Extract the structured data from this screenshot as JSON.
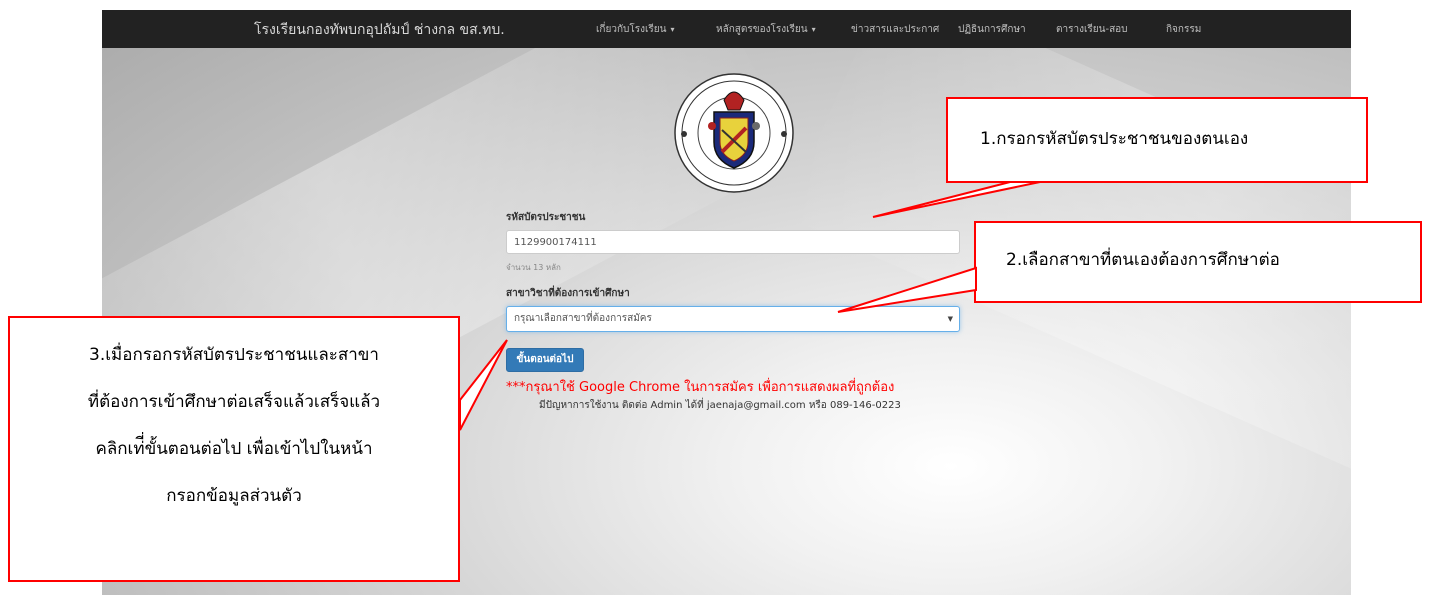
{
  "navbar": {
    "brand": "โรงเรียนกองทัพบกอุปถัมป์ ช่างกล ขส.ทบ.",
    "items": [
      {
        "label": "เกี่ยวกับโรงเรียน",
        "dropdown": true
      },
      {
        "label": "หลักสูตรของโรงเรียน",
        "dropdown": true
      },
      {
        "label": "ข่าวสารและประกาศ",
        "dropdown": false
      },
      {
        "label": "ปฏิธินการศึกษา",
        "dropdown": false
      },
      {
        "label": "ตารางเรียน-สอบ",
        "dropdown": false
      },
      {
        "label": "กิจกรรม",
        "dropdown": false
      }
    ],
    "caret": "▾"
  },
  "form": {
    "id_label": "รหัสบัตรประชาชน",
    "id_value": "1129900174111",
    "id_help": "จำนวน 13 หลัก",
    "major_label": "สาขาวิชาที่ต้องการเข้าศึกษา",
    "major_selected": "กรุณาเลือกสาขาที่ต้องการสมัคร",
    "select_arrow": "▼",
    "next_button": "ขั้นตอนต่อไป",
    "warning": "***กรุณาใช้ Google Chrome ในการสมัคร เพื่อการแสดงผลที่ถูกต้อง",
    "contact": "มีปัญหาการใช้งาน ติดต่อ Admin ได้ที่ jaenaja@gmail.com หรือ 089-146-0223"
  },
  "callouts": {
    "step1": "1.กรอกรหัสบัตรประชาชนของตนเอง",
    "step2": "2.เลือกสาขาที่ตนเองต้องการศึกษาต่อ",
    "step3_lines": [
      "3.เมื่อกรอกรหัสบัตรประชาชนและสาขา",
      "ที่ต้องการเข้าศึกษาต่อเสร็จแล้วเสร็จแล้ว",
      "คลิกเท่ี่ขั้นตอนต่อไป เพื่อเข้าไปในหน้า",
      "กรอกข้อมูลส่วนตัว"
    ]
  },
  "colors": {
    "navbar_bg": "#222222",
    "button_bg": "#337ab7",
    "warning": "#ff0000",
    "callout_border": "#ff0000"
  }
}
